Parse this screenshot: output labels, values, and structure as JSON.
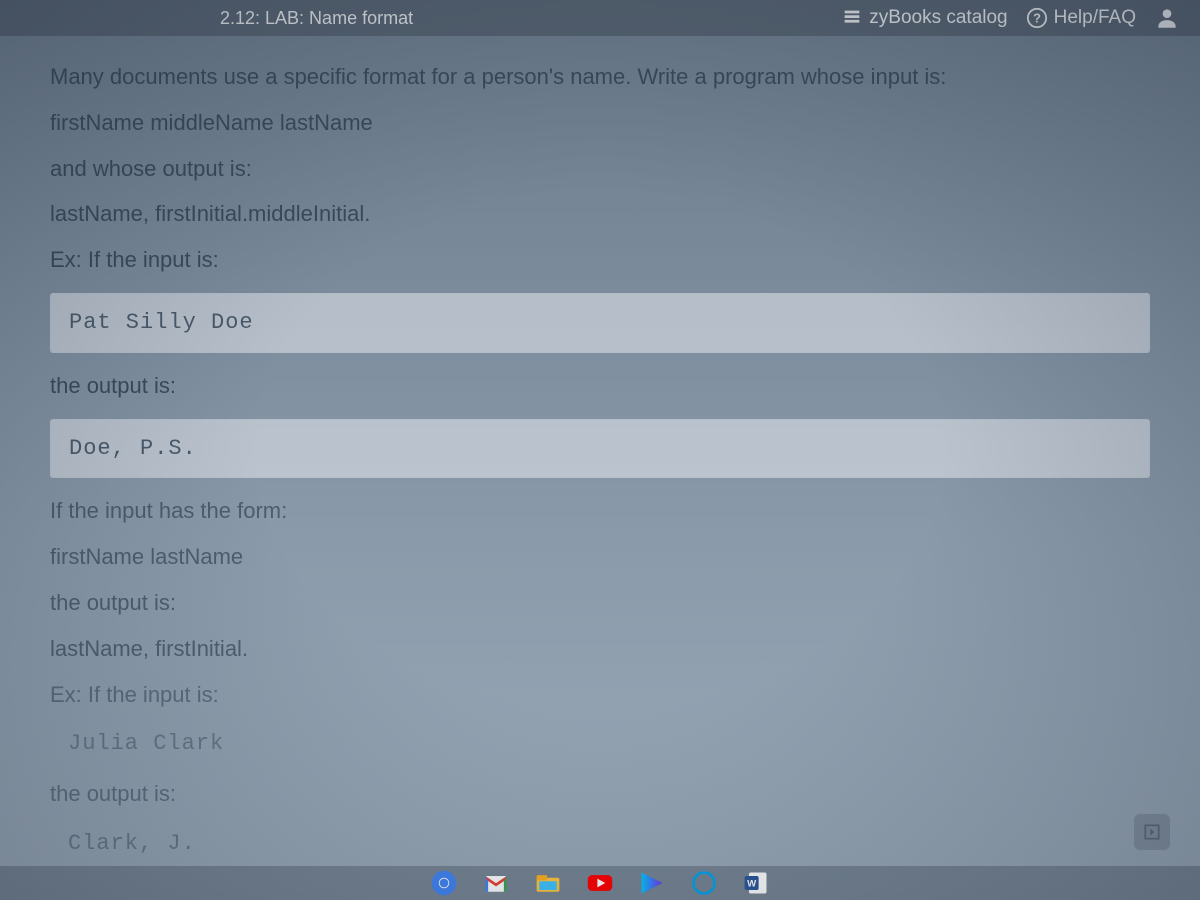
{
  "header": {
    "title": "2.12: LAB: Name format",
    "catalog_label": "zyBooks catalog",
    "help_label": "Help/FAQ"
  },
  "content": {
    "p1": "Many documents use a specific format for a person's name. Write a program whose input is:",
    "p2": "firstName middleName lastName",
    "p3": "and whose output is:",
    "p4": "lastName, firstInitial.middleInitial.",
    "p5": "Ex: If the input is:",
    "code1": "Pat Silly Doe",
    "p6": "the output is:",
    "code2": "Doe, P.S.",
    "p7": "If the input has the form:",
    "p8": "firstName lastName",
    "p9": "the output is:",
    "p10": "lastName, firstInitial.",
    "p11": "Ex: If the input is:",
    "code3": "Julia Clark",
    "p12": "the output is:",
    "code4": "Clark, J."
  },
  "taskbar": {
    "icons": [
      "chrome",
      "gmail",
      "file-explorer",
      "youtube",
      "video",
      "cortana",
      "word"
    ]
  }
}
